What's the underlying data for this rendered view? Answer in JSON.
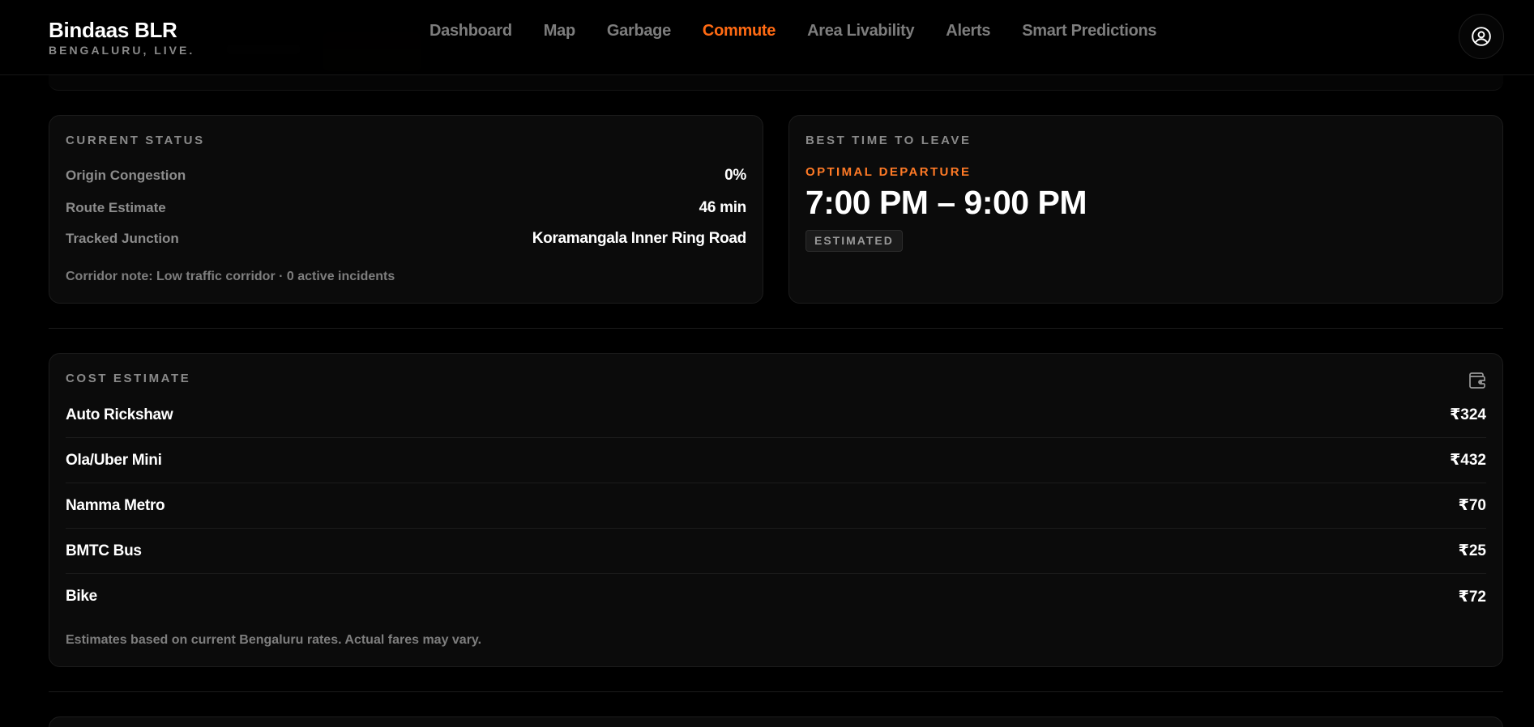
{
  "header": {
    "brand_title": "Bindaas BLR",
    "brand_subtitle": "BENGALURU, LIVE.",
    "nav": [
      {
        "label": "Dashboard",
        "active": false
      },
      {
        "label": "Map",
        "active": false
      },
      {
        "label": "Garbage",
        "active": false
      },
      {
        "label": "Commute",
        "active": true
      },
      {
        "label": "Area Livability",
        "active": false
      },
      {
        "label": "Alerts",
        "active": false
      },
      {
        "label": "Smart Predictions",
        "active": false
      }
    ],
    "profile_icon": "user-circle-icon"
  },
  "current_status": {
    "title": "CURRENT STATUS",
    "rows": [
      {
        "label": "Origin Congestion",
        "value": "0%"
      },
      {
        "label": "Route Estimate",
        "value": "46 min"
      },
      {
        "label": "Tracked Junction",
        "value": "Koramangala Inner Ring Road"
      }
    ],
    "note": "Corridor note: Low traffic corridor · 0 active incidents"
  },
  "best_time": {
    "title": "BEST TIME TO LEAVE",
    "subtitle": "OPTIMAL DEPARTURE",
    "time": "7:00 PM – 9:00 PM",
    "badge": "ESTIMATED"
  },
  "cost_estimate": {
    "title": "COST ESTIMATE",
    "icon": "wallet-icon",
    "items": [
      {
        "mode": "Auto Rickshaw",
        "price": "₹324"
      },
      {
        "mode": "Ola/Uber Mini",
        "price": "₹432"
      },
      {
        "mode": "Namma Metro",
        "price": "₹70"
      },
      {
        "mode": "BMTC Bus",
        "price": "₹25"
      },
      {
        "mode": "Bike",
        "price": "₹72"
      }
    ],
    "disclaimer": "Estimates based on current Bengaluru rates. Actual fares may vary."
  },
  "colors": {
    "accent": "#ff6a13",
    "background": "#000000",
    "card": "#0b0b0b",
    "muted_text": "#8a8a8a"
  }
}
